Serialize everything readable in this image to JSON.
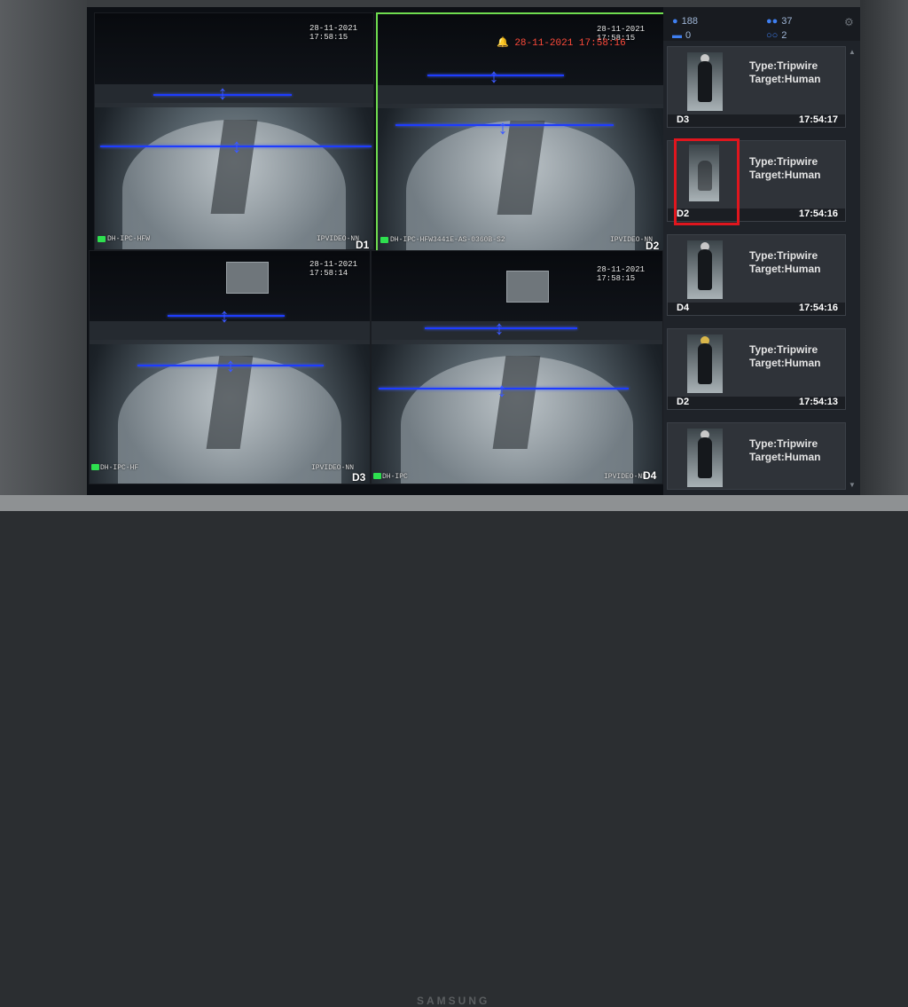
{
  "monitor": {
    "brand": "SAMSUNG"
  },
  "cameras": [
    {
      "id": "D1",
      "timestamp": "28-11-2021 17:58:15",
      "name_overlay": "DH-IPC-HFW",
      "site": "IPVIDEO-NN"
    },
    {
      "id": "D2",
      "timestamp": "28-11-2021 17:58:15",
      "alarm_time": "28-11-2021 17:58:16",
      "name_overlay": "DH-IPC-HFW3441E-AS-0360B-S2",
      "site": "IPVIDEO-NN"
    },
    {
      "id": "D3",
      "timestamp": "28-11-2021 17:58:14",
      "name_overlay": "DH-IPC-HF",
      "site": "IPVIDEO-NN"
    },
    {
      "id": "D4",
      "timestamp": "28-11-2021 17:58:15",
      "name_overlay": "DH-IPC",
      "site": "IPVIDEO-NN"
    }
  ],
  "stats": {
    "humans": "188",
    "vehicles": "0",
    "people_group": "37",
    "bikes": "2"
  },
  "events": [
    {
      "type": "Type:Tripwire",
      "target": "Target:Human",
      "channel": "D3",
      "time": "17:54:17"
    },
    {
      "type": "Type:Tripwire",
      "target": "Target:Human",
      "channel": "D2",
      "time": "17:54:16"
    },
    {
      "type": "Type:Tripwire",
      "target": "Target:Human",
      "channel": "D4",
      "time": "17:54:16"
    },
    {
      "type": "Type:Tripwire",
      "target": "Target:Human",
      "channel": "D2",
      "time": "17:54:13"
    },
    {
      "type": "Type:Tripwire",
      "target": "Target:Human",
      "channel": "",
      "time": ""
    }
  ],
  "colors": {
    "selected_border": "#6fdc4f",
    "tripwire": "#1e3cff",
    "highlight": "#e0161e"
  }
}
